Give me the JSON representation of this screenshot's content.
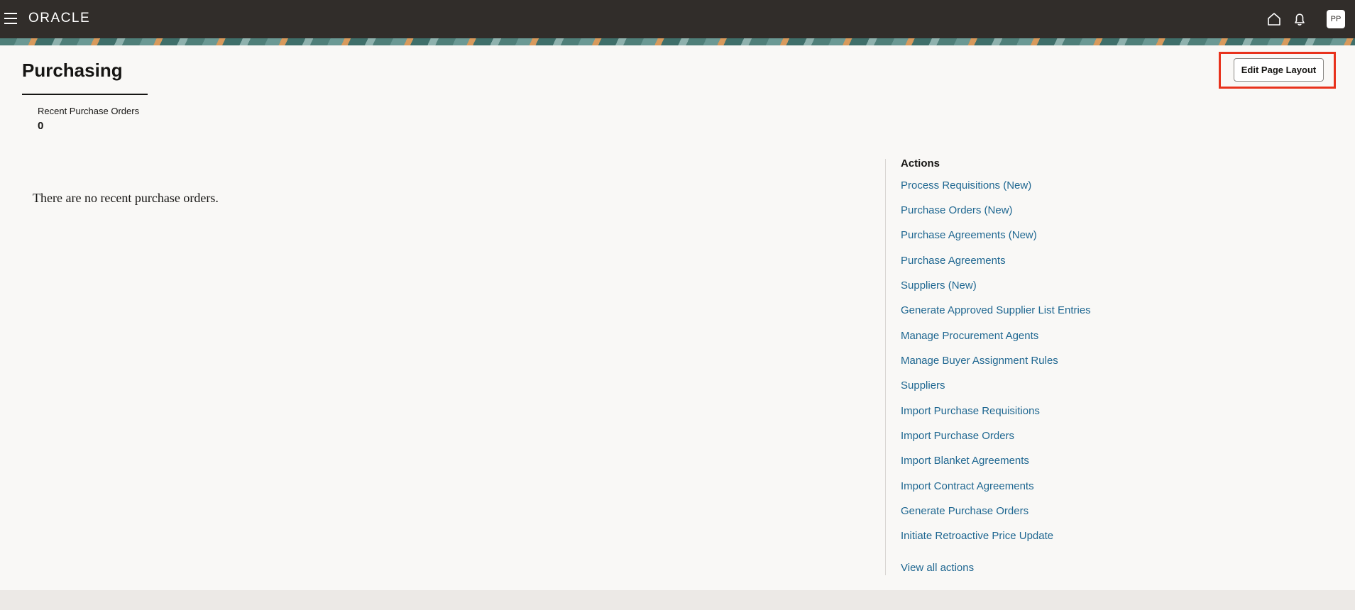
{
  "header": {
    "logo": "ORACLE",
    "avatar_initials": "PP",
    "icons": [
      "hamburger-menu-icon",
      "home-icon",
      "notifications-bell-icon"
    ]
  },
  "page": {
    "title": "Purchasing",
    "edit_layout_label": "Edit Page Layout"
  },
  "stats": {
    "label": "Recent Purchase Orders",
    "value": "0"
  },
  "empty_message": "There are no recent purchase orders.",
  "actions": {
    "heading": "Actions",
    "items": [
      "Process Requisitions (New)",
      "Purchase Orders (New)",
      "Purchase Agreements (New)",
      "Purchase Agreements",
      "Suppliers (New)",
      "Generate Approved Supplier List Entries",
      "Manage Procurement Agents",
      "Manage Buyer Assignment Rules",
      "Suppliers",
      "Import Purchase Requisitions",
      "Import Purchase Orders",
      "Import Blanket Agreements",
      "Import Contract Agreements",
      "Generate Purchase Orders",
      "Initiate Retroactive Price Update"
    ],
    "view_all": "View all actions"
  },
  "colors": {
    "topbar": "#312d2a",
    "link": "#1f6791",
    "highlight": "#e8321c"
  }
}
